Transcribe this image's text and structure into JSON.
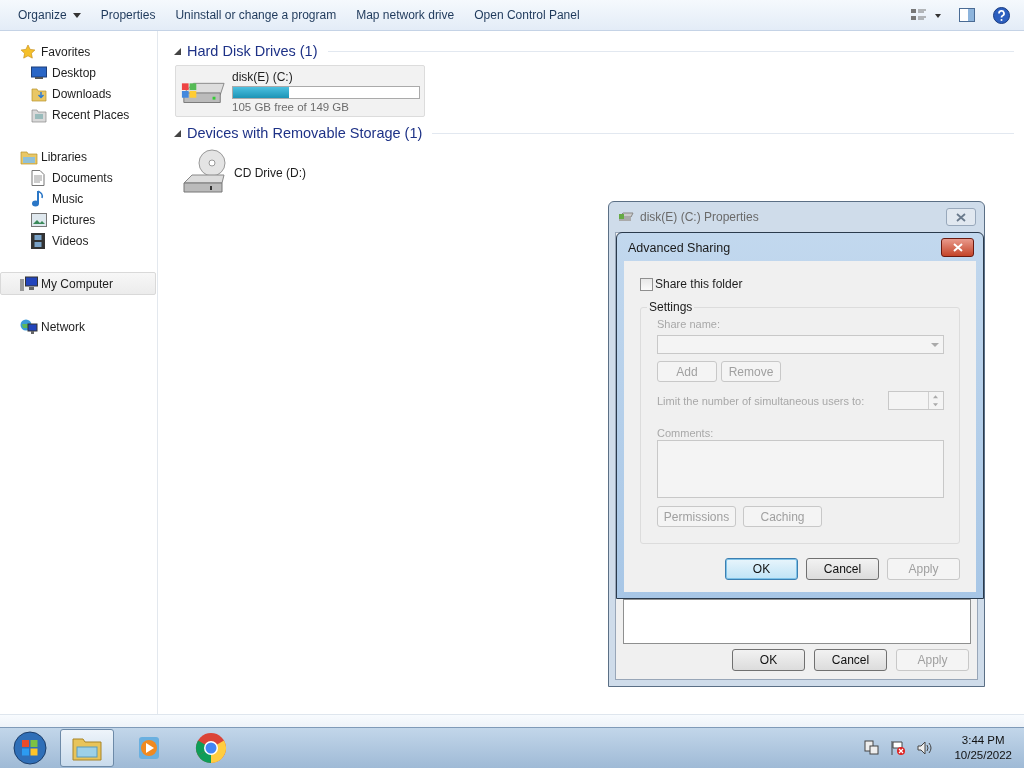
{
  "toolbar": {
    "items": [
      {
        "label": "Organize",
        "kind": "menu"
      },
      {
        "label": "Properties",
        "kind": "command"
      },
      {
        "label": "Uninstall or change a program",
        "kind": "command"
      },
      {
        "label": "Map network drive",
        "kind": "command"
      },
      {
        "label": "Open Control Panel",
        "kind": "command"
      }
    ]
  },
  "sidebar": {
    "groups": [
      {
        "label": "Favorites",
        "kind": "star",
        "selected": false,
        "children": [
          {
            "label": "Desktop",
            "kind": "desktop",
            "selected": false
          },
          {
            "label": "Downloads",
            "kind": "download",
            "selected": false
          },
          {
            "label": "Recent Places",
            "kind": "recent",
            "selected": false
          }
        ]
      },
      {
        "label": "Libraries",
        "kind": "library",
        "selected": false,
        "children": [
          {
            "label": "Documents",
            "kind": "document",
            "selected": false
          },
          {
            "label": "Music",
            "kind": "music",
            "selected": false
          },
          {
            "label": "Pictures",
            "kind": "pictures",
            "selected": false
          },
          {
            "label": "Videos",
            "kind": "videos",
            "selected": false
          }
        ]
      },
      {
        "label": "My Computer",
        "kind": "computer",
        "selected": true
      },
      {
        "label": "Network",
        "kind": "network",
        "selected": false
      }
    ]
  },
  "sections": [
    {
      "title": "Hard Disk Drives (1)",
      "items": [
        {
          "name": "disk(E) (C:)",
          "kind": "disk",
          "selected": true,
          "level": 0.3,
          "detail": "105 GB free of 149 GB"
        }
      ]
    },
    {
      "title": "Devices with Removable Storage (1)",
      "items": [
        {
          "name": "CD Drive (D:)",
          "kind": "cd",
          "selected": false
        }
      ]
    }
  ],
  "properties_dialog": {
    "title": "disk(E) (C:) Properties",
    "buttons": [
      {
        "label": "OK",
        "disabled": false
      },
      {
        "label": "Cancel",
        "disabled": false
      },
      {
        "label": "Apply",
        "disabled": true
      }
    ]
  },
  "advanced_sharing": {
    "title": "Advanced Sharing",
    "share_checkbox": {
      "label": "Share this folder",
      "checked": false
    },
    "settings": {
      "title": "Settings",
      "disabled": true,
      "share_name_label": "Share name:",
      "add": "Add",
      "remove": "Remove",
      "limit_label": "Limit the number of simultaneous users to:",
      "comments_label": "Comments:",
      "permissions": "Permissions",
      "caching": "Caching"
    },
    "buttons": [
      {
        "label": "OK",
        "default": true,
        "disabled": false
      },
      {
        "label": "Cancel",
        "default": false,
        "disabled": false
      },
      {
        "label": "Apply",
        "default": false,
        "disabled": true
      }
    ]
  },
  "taskbar": {
    "apps": [
      {
        "kind": "explorer",
        "selected": true
      },
      {
        "kind": "media",
        "selected": false
      },
      {
        "kind": "chrome",
        "selected": false
      }
    ],
    "time": "3:44 PM",
    "date": "10/25/2022"
  }
}
